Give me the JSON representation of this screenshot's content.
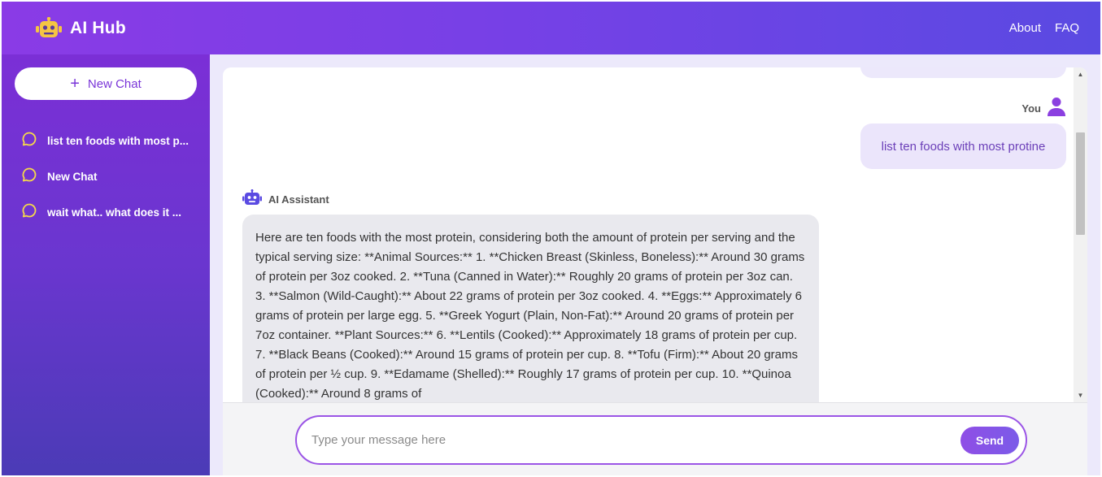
{
  "header": {
    "brand_title": "AI Hub",
    "brand_icon": "robot-icon",
    "nav": [
      {
        "label": "About"
      },
      {
        "label": "FAQ"
      }
    ]
  },
  "sidebar": {
    "new_chat_label": "New Chat",
    "history": [
      {
        "label": "list ten foods with most p..."
      },
      {
        "label": "New Chat"
      },
      {
        "label": "wait what.. what does it ..."
      }
    ]
  },
  "chat": {
    "user_label": "You",
    "assistant_label": "AI Assistant",
    "user_message": "list ten foods with most protine",
    "assistant_message": "Here are ten foods with the most protein, considering both the amount of protein per serving and the typical serving size: **Animal Sources:** 1. **Chicken Breast (Skinless, Boneless):** Around 30 grams of protein per 3oz cooked. 2. **Tuna (Canned in Water):** Roughly 20 grams of protein per 3oz can. 3. **Salmon (Wild-Caught):** About 22 grams of protein per 3oz cooked. 4. **Eggs:** Approximately 6 grams of protein per large egg. 5. **Greek Yogurt (Plain, Non-Fat):** Around 20 grams of protein per 7oz container. **Plant Sources:** 6. **Lentils (Cooked):** Approximately 18 grams of protein per cup. 7. **Black Beans (Cooked):** Around 15 grams of protein per cup. 8. **Tofu (Firm):** About 20 grams of protein per ½ cup. 9. **Edamame (Shelled):** Roughly 17 grams of protein per cup. 10. **Quinoa (Cooked):** Around 8 grams of"
  },
  "composer": {
    "placeholder": "Type your message here",
    "value": "",
    "send_label": "Send"
  },
  "colors": {
    "accent": "#7b2fd6",
    "header_start": "#8a3be6",
    "header_end": "#5a4ae2",
    "history_icon": "#f5d94a",
    "user_avatar": "#8b3fe0",
    "bot_icon": "#5a4ae2"
  }
}
